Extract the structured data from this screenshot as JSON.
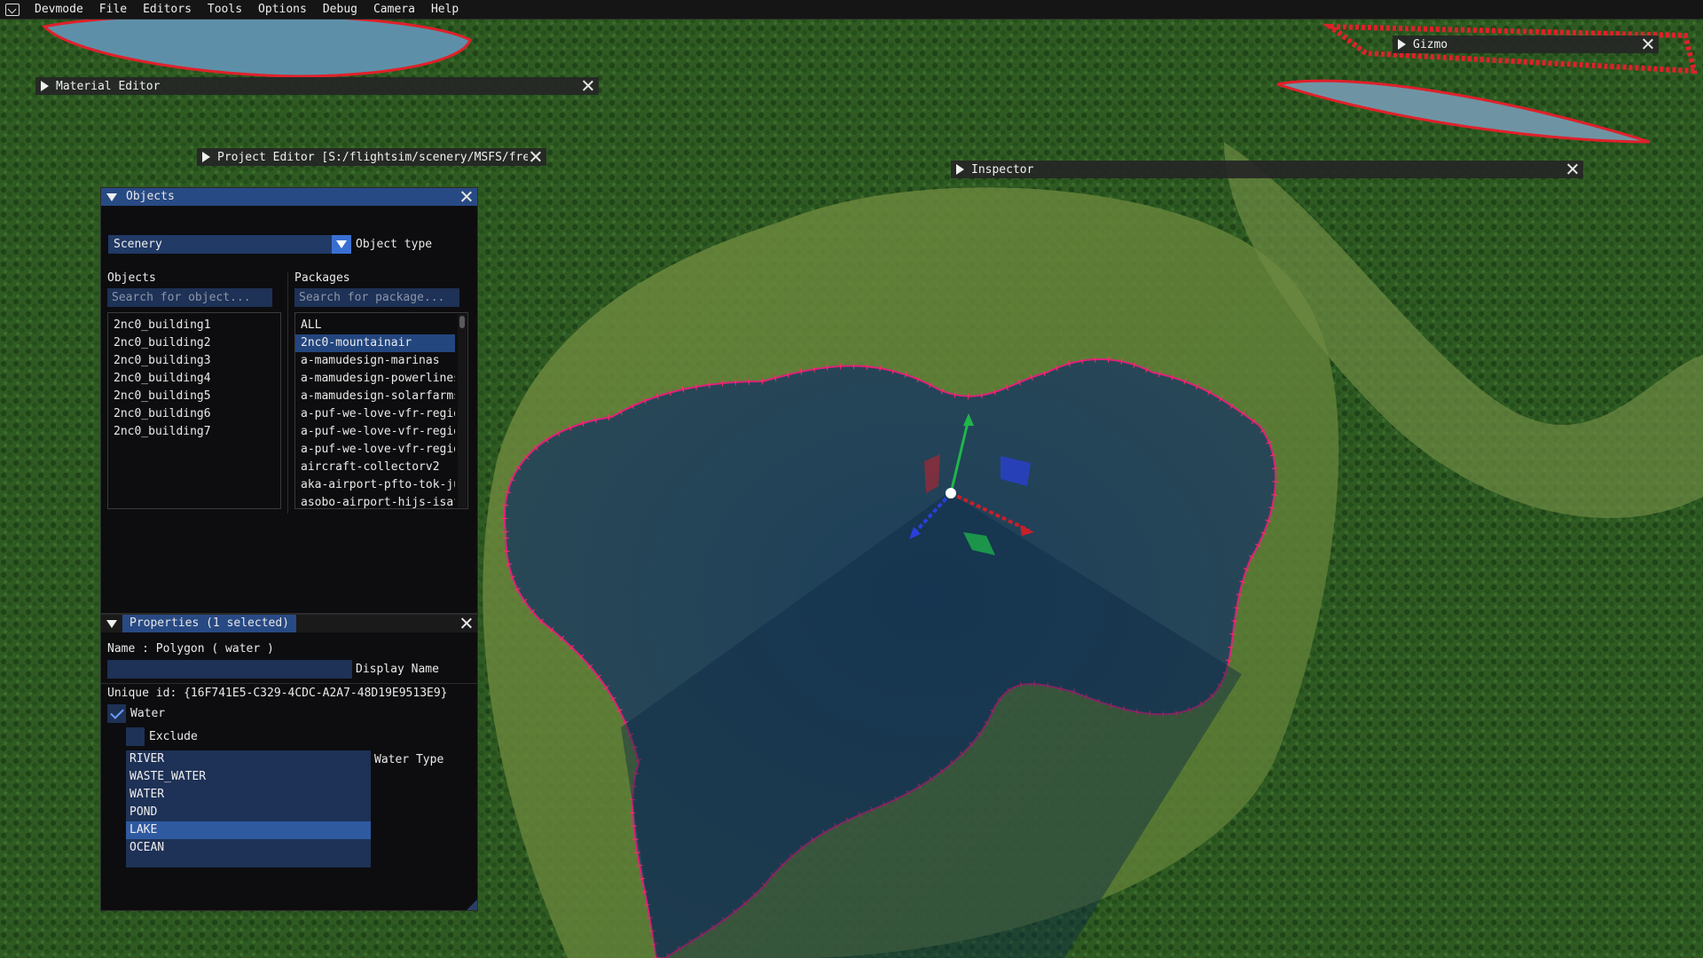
{
  "menubar": {
    "app_title": "Devmode",
    "items": [
      "File",
      "Editors",
      "Tools",
      "Options",
      "Debug",
      "Camera",
      "Help"
    ]
  },
  "windows": {
    "material_editor": "Material Editor",
    "project_editor": "Project Editor [S:/flightsim/scenery/MSFS/freewar",
    "inspector": "Inspector",
    "gizmo": "Gizmo"
  },
  "objects_panel": {
    "title": "Objects",
    "object_type_value": "Scenery",
    "object_type_label": "Object type",
    "objects_header": "Objects",
    "packages_header": "Packages",
    "object_search_placeholder": "Search for object...",
    "package_search_placeholder": "Search for package...",
    "objects": [
      "2nc0_building1",
      "2nc0_building2",
      "2nc0_building3",
      "2nc0_building4",
      "2nc0_building5",
      "2nc0_building6",
      "2nc0_building7"
    ],
    "packages": [
      "ALL",
      "2nc0-mountainair",
      "a-mamudesign-marinas",
      "a-mamudesign-powerlines",
      "a-mamudesign-solarfarms",
      "a-puf-we-love-vfr-regio",
      "a-puf-we-love-vfr-regio",
      "a-puf-we-love-vfr-regio",
      "aircraft-collectorv2",
      "aka-airport-pfto-tok-ju",
      "asobo-airport-hijs-isaf"
    ],
    "selected_package": "2nc0-mountainair"
  },
  "properties_panel": {
    "title": "Properties (1 selected)",
    "name_line": "Name : Polygon  ( water )",
    "display_name_value": "",
    "display_name_label": "Display Name",
    "unique_id": "Unique id: {16F741E5-C329-4CDC-A2A7-48D19E9513E9}",
    "water_label": "Water",
    "water_checked": true,
    "exclude_label": "Exclude",
    "exclude_checked": false,
    "water_type_label": "Water Type",
    "water_types": [
      "RIVER",
      "WASTE_WATER",
      "WATER",
      "POND",
      "LAKE",
      "OCEAN"
    ],
    "selected_water_type": "LAKE"
  },
  "colors": {
    "title_active": "#284a84",
    "selection": "#23467f",
    "gizmo_x": "#c8202a",
    "gizmo_y": "#1fb64a",
    "gizmo_z": "#2a3fd8",
    "polygon_outline": "#e0207a"
  }
}
